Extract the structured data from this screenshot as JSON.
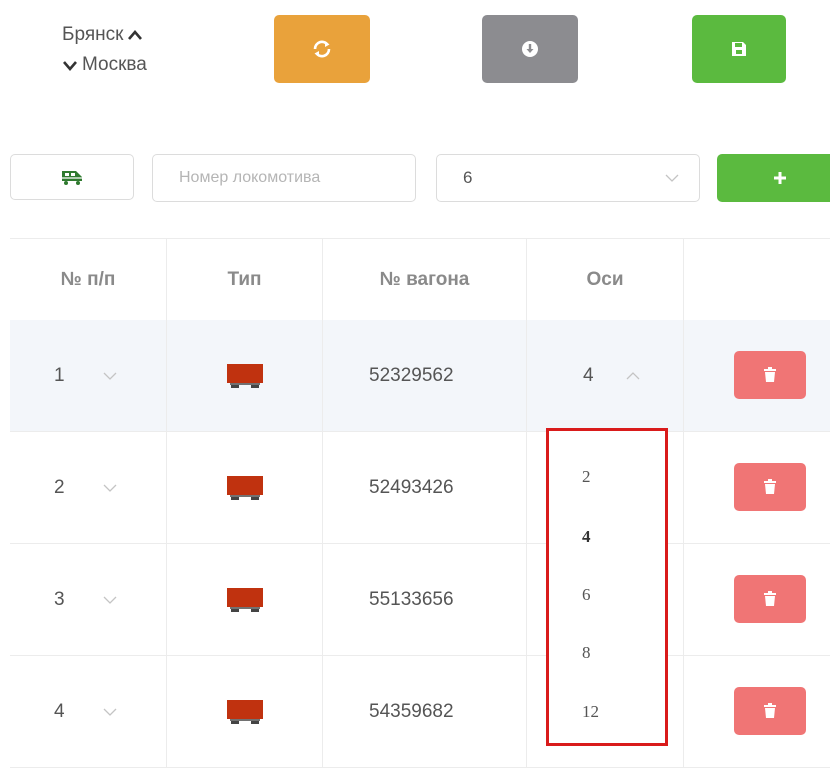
{
  "route": {
    "from": "Брянск",
    "to": "Москва"
  },
  "toolbar": {
    "refresh": "refresh-icon",
    "download": "download-icon",
    "save": "save-icon"
  },
  "locomotive": {
    "input_placeholder": "Номер локомотива",
    "input_value": "",
    "axle_value": "6"
  },
  "table": {
    "headers": {
      "num": "№ п/п",
      "type": "Тип",
      "wagon": "№ вагона",
      "axles": "Оси"
    },
    "rows": [
      {
        "num": "1",
        "wagon": "52329562",
        "axles": "4"
      },
      {
        "num": "2",
        "wagon": "52493426",
        "axles": ""
      },
      {
        "num": "3",
        "wagon": "55133656",
        "axles": ""
      },
      {
        "num": "4",
        "wagon": "54359682",
        "axles": ""
      }
    ]
  },
  "axle_dropdown": {
    "options": [
      "2",
      "4",
      "6",
      "8",
      "12"
    ],
    "selected": "4"
  },
  "colors": {
    "orange": "#e9a23b",
    "gray": "#8c8c90",
    "green": "#5bba3f",
    "red": "#f07575",
    "wagon": "#c0320f",
    "highlight": "#d91b1b"
  }
}
